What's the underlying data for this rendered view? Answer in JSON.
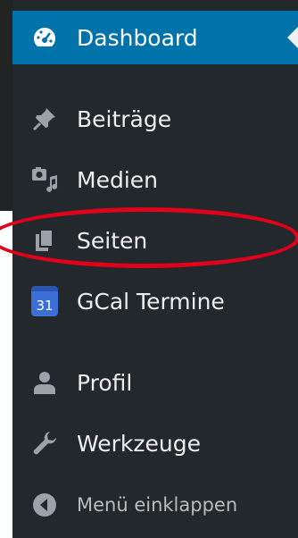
{
  "menu": {
    "items": [
      {
        "label": "Dashboard",
        "icon": "dashboard-icon",
        "active": true
      },
      {
        "label": "Beiträge",
        "icon": "pin-icon"
      },
      {
        "label": "Medien",
        "icon": "media-icon"
      },
      {
        "label": "Seiten",
        "icon": "pages-icon"
      },
      {
        "label": "GCal Termine",
        "icon": "calendar-icon",
        "badge": "31"
      },
      {
        "label": "Profil",
        "icon": "user-icon"
      },
      {
        "label": "Werkzeuge",
        "icon": "wrench-icon"
      }
    ],
    "collapse_label": "Menü einklappen"
  },
  "colors": {
    "menu_bg": "#23282d",
    "active_bg": "#0073aa",
    "highlight": "#e0001b"
  }
}
